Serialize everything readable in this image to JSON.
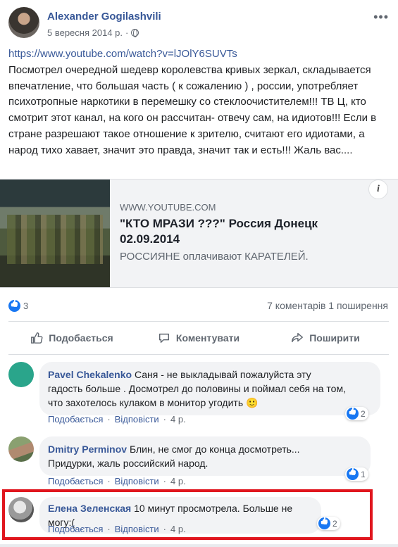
{
  "post": {
    "author": "Alexander Gogilashvili",
    "date": "5 вересня 2014 р.",
    "separator": "·",
    "more_icon": "more-dots-icon",
    "link": "https://www.youtube.com/watch?v=lJOlY6SUVTs",
    "text": "Посмотрел очередной шедевр королевства кривых зеркал, складывается впечатление, что большая часть ( к сожалению ) , россии, употребляет психотропные наркотики в перемешку со стеклоочистителем!!! ТВ Ц, кто смотрит этот канал, на кого он рассчитан- отвечу сам, на идиотов!!! Если в стране разрешают такое отношение к зрителю, считают его идиотами, а народ тихо хавает, значит это правда, значит так и есть!!! Жаль вас...."
  },
  "preview": {
    "domain": "WWW.YOUTUBE.COM",
    "title": "\"КТО МРАЗИ ???\" Россия Донецк 02.09.2014",
    "description": "РОССИЯНЕ оплачивают КАРАТЕЛЕЙ.",
    "info_label": "i"
  },
  "stats": {
    "likes": "3",
    "comments_shares": "7 коментарів  1 поширення"
  },
  "actions": {
    "like": "Подобається",
    "comment": "Коментувати",
    "share": "Поширити"
  },
  "comment_actions": {
    "like": "Подобається",
    "reply": "Відповісти",
    "dot": "·"
  },
  "comments": [
    {
      "name": "Pavel Chekalenko",
      "text_line1": "Саня - не выкладывай пожалуйста эту",
      "text_line2": "гадость больше . Досмотрел до половины и поймал себя на том,",
      "text_line3": "что захотелось кулаком в монитор угодить 🙂",
      "age": "4 р.",
      "reactions": "2"
    },
    {
      "name": "Dmitry Perminov",
      "text_line1": "Блин, не смог до конца досмотреть...",
      "text_line2": "Придурки, жаль российский народ.",
      "age": "4 р.",
      "reactions": "1"
    },
    {
      "name": "Елена Зеленская",
      "text_line1": "10 минут просмотрела. Больше не могу:(",
      "age": "4 р.",
      "reactions": "2"
    }
  ],
  "colors": {
    "link_blue": "#385898",
    "like_blue": "#1877f2",
    "highlight_red": "#e0161e",
    "avatar_teal": "#2aa58b"
  }
}
